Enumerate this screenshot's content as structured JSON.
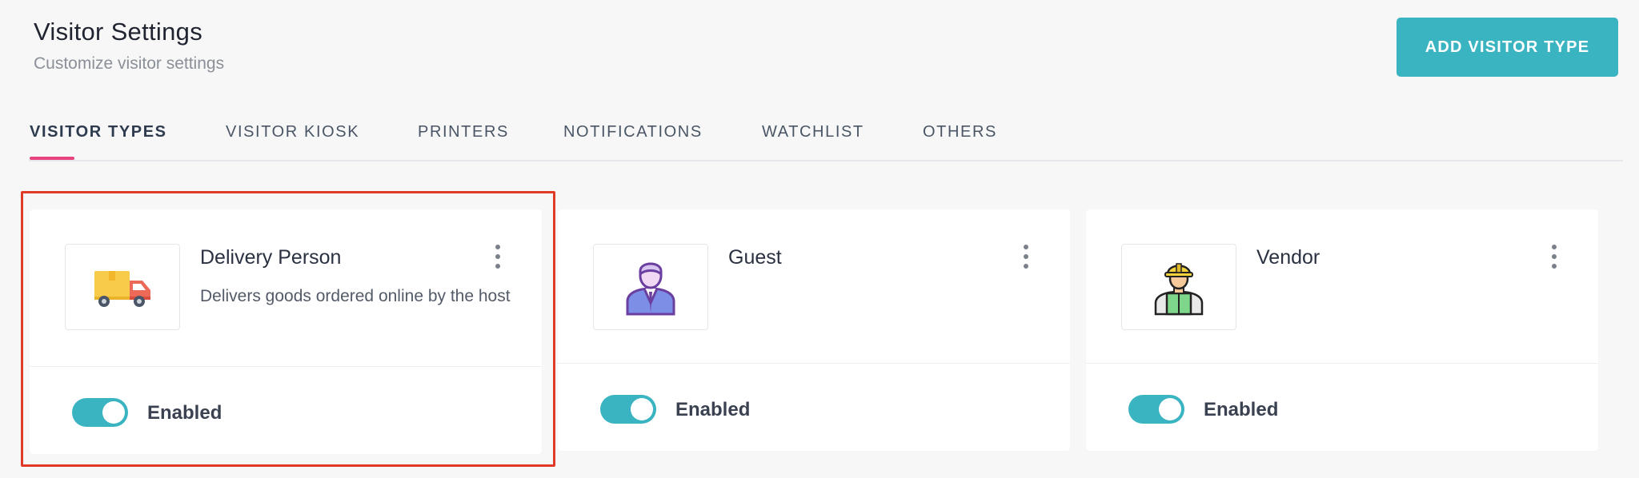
{
  "header": {
    "title": "Visitor Settings",
    "subtitle": "Customize visitor settings",
    "add_button_label": "ADD VISITOR TYPE"
  },
  "tabs": [
    {
      "label": "VISITOR TYPES",
      "active": true
    },
    {
      "label": "VISITOR KIOSK",
      "active": false
    },
    {
      "label": "PRINTERS",
      "active": false
    },
    {
      "label": "NOTIFICATIONS",
      "active": false
    },
    {
      "label": "WATCHLIST",
      "active": false
    },
    {
      "label": "OTHERS",
      "active": false
    }
  ],
  "visitor_types": [
    {
      "name": "Delivery Person",
      "description": "Delivers goods ordered online by the host",
      "icon": "delivery-truck-icon",
      "enabled": true,
      "status_label": "Enabled",
      "selected": true
    },
    {
      "name": "Guest",
      "description": "",
      "icon": "guest-person-icon",
      "enabled": true,
      "status_label": "Enabled",
      "selected": false
    },
    {
      "name": "Vendor",
      "description": "",
      "icon": "construction-worker-icon",
      "enabled": true,
      "status_label": "Enabled",
      "selected": false
    }
  ],
  "colors": {
    "accent": "#3bb4c1",
    "tab_indicator": "#e8437f",
    "selection_outline": "#e13a26",
    "background": "#f7f7f7"
  }
}
